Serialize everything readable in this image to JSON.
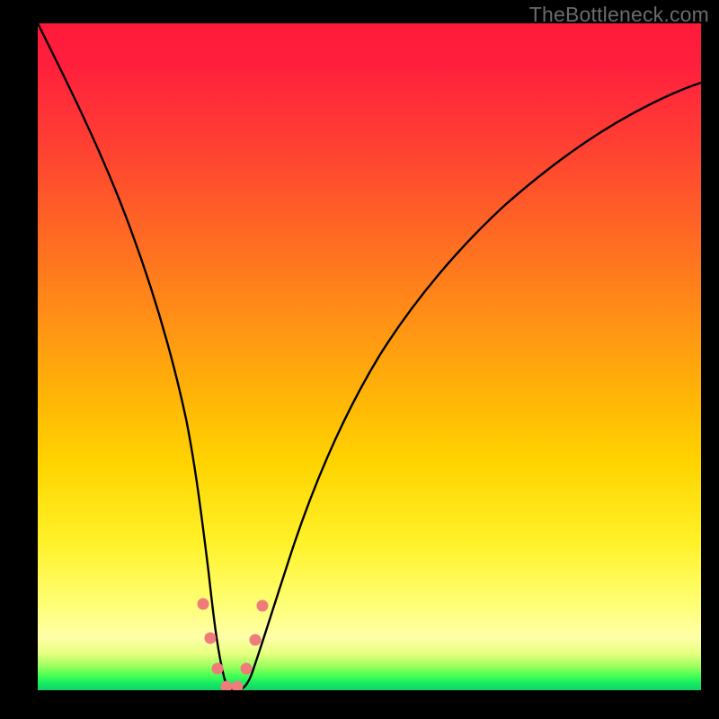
{
  "watermark": "TheBottleneck.com",
  "chart_data": {
    "type": "line",
    "title": "",
    "xlabel": "",
    "ylabel": "",
    "xlim": [
      0,
      100
    ],
    "ylim": [
      0,
      100
    ],
    "grid": false,
    "legend": false,
    "background_gradient": {
      "orientation": "vertical",
      "stops": [
        {
          "pos": 0,
          "color": "#ff1a3a",
          "meaning": "high bottleneck"
        },
        {
          "pos": 50,
          "color": "#ffb208"
        },
        {
          "pos": 80,
          "color": "#fff22a"
        },
        {
          "pos": 96,
          "color": "#97ff5d"
        },
        {
          "pos": 100,
          "color": "#0ed66a",
          "meaning": "no bottleneck"
        }
      ]
    },
    "series": [
      {
        "name": "bottleneck-curve",
        "color": "#000000",
        "x": [
          0,
          3,
          6,
          9,
          12,
          15,
          18,
          20,
          22,
          24,
          25.5,
          27,
          28.5,
          30,
          32,
          35,
          40,
          45,
          50,
          55,
          60,
          65,
          70,
          75,
          80,
          85,
          90,
          95,
          100
        ],
        "y": [
          100,
          93,
          85,
          77,
          69,
          60,
          50,
          42,
          33,
          22,
          12,
          4,
          0,
          0,
          4,
          12,
          26,
          37,
          47,
          55,
          62,
          68,
          73,
          77,
          80.5,
          83.5,
          86,
          88,
          90
        ]
      }
    ],
    "markers": {
      "name": "highlight-points",
      "color": "#ef7b7b",
      "radius_px": 6,
      "points": [
        {
          "x": 24.0,
          "y": 13
        },
        {
          "x": 25.5,
          "y": 7
        },
        {
          "x": 27.0,
          "y": 2
        },
        {
          "x": 28.0,
          "y": 0
        },
        {
          "x": 29.5,
          "y": 0
        },
        {
          "x": 30.5,
          "y": 2
        },
        {
          "x": 32.0,
          "y": 7
        },
        {
          "x": 33.0,
          "y": 13
        }
      ]
    },
    "baseline": {
      "name": "zero-line",
      "color": "#15d466",
      "y": 0
    }
  }
}
